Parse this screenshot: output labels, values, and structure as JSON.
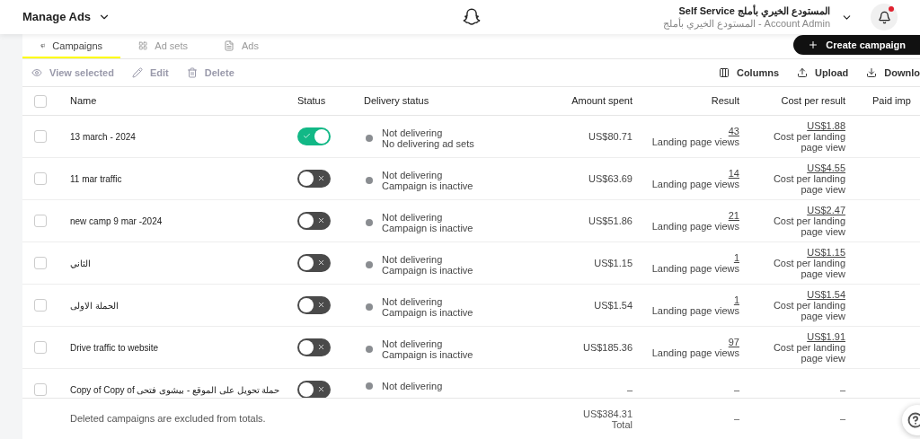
{
  "header": {
    "title": "Manage Ads",
    "account_name": "Self Service المستودع الخيري بأملج",
    "account_role": "المستودع الخيري بأملج - Account Admin",
    "notification_unread": true
  },
  "tabs": [
    {
      "label": "Campaigns",
      "selected": true
    },
    {
      "label": "Ad sets",
      "selected": false
    },
    {
      "label": "Ads",
      "selected": false
    }
  ],
  "create_button": "Create campaign",
  "toolbar_left": [
    {
      "label": "View selected",
      "kind": "view"
    },
    {
      "label": "Edit",
      "kind": "edit"
    },
    {
      "label": "Delete",
      "kind": "delete"
    }
  ],
  "toolbar_right": [
    {
      "label": "Columns",
      "kind": "columns"
    },
    {
      "label": "Upload",
      "kind": "upload"
    },
    {
      "label": "Downlo",
      "kind": "download"
    }
  ],
  "table": {
    "select_all_checked": false,
    "columns": [
      "Name",
      "Status",
      "Delivery status",
      "Amount spent",
      "Result",
      "Cost per result",
      "Paid imp"
    ],
    "rows": [
      {
        "checked": false,
        "name": "13 march - 2024",
        "on": true,
        "delivery": "Not delivering",
        "delivery_detail": "No delivering ad sets",
        "color": "#8a8d91",
        "amount": "US$80.71",
        "result": "43",
        "result_label": "Landing page views",
        "cost": "US$1.88",
        "cost_label": "Cost per landing page view"
      },
      {
        "checked": false,
        "name": "11 mar traffic",
        "on": false,
        "delivery": "Not delivering",
        "delivery_detail": "Campaign is inactive",
        "color": "#8a8d91",
        "amount": "US$63.69",
        "result": "14",
        "result_label": "Landing page views",
        "cost": "US$4.55",
        "cost_label": "Cost per landing page view"
      },
      {
        "checked": false,
        "name": "new camp 9 mar -2024",
        "on": false,
        "delivery": "Not delivering",
        "delivery_detail": "Campaign is inactive",
        "color": "#8a8d91",
        "amount": "US$51.86",
        "result": "21",
        "result_label": "Landing page views",
        "cost": "US$2.47",
        "cost_label": "Cost per landing page view"
      },
      {
        "checked": false,
        "name": "الثاني",
        "on": false,
        "delivery": "Not delivering",
        "delivery_detail": "Campaign is inactive",
        "color": "#8a8d91",
        "amount": "US$1.15",
        "result": "1",
        "result_label": "Landing page views",
        "cost": "US$1.15",
        "cost_label": "Cost per landing page view"
      },
      {
        "checked": false,
        "name": "الحملة الاولى",
        "on": false,
        "delivery": "Not delivering",
        "delivery_detail": "Campaign is inactive",
        "color": "#8a8d91",
        "amount": "US$1.54",
        "result": "1",
        "result_label": "Landing page views",
        "cost": "US$1.54",
        "cost_label": "Cost per landing page view"
      },
      {
        "checked": false,
        "name": "Drive traffic to website",
        "on": false,
        "delivery": "Not delivering",
        "delivery_detail": "Campaign is inactive",
        "color": "#8a8d91",
        "amount": "US$185.36",
        "result": "97",
        "result_label": "Landing page views",
        "cost": "US$1.91",
        "cost_label": "Cost per landing page view"
      },
      {
        "checked": false,
        "name": "Copy of Copy of حملة تحويل على الموقع - بيشوى فتحى",
        "on": false,
        "delivery": "Not delivering",
        "color": "#8a8d91",
        "amount": "–",
        "result": "–",
        "cost": "–"
      }
    ]
  },
  "footer": {
    "note": "Deleted campaigns are excluded from totals.",
    "total_amount": "US$384.31",
    "total_label": "Total",
    "result": "–",
    "cost": "–"
  }
}
